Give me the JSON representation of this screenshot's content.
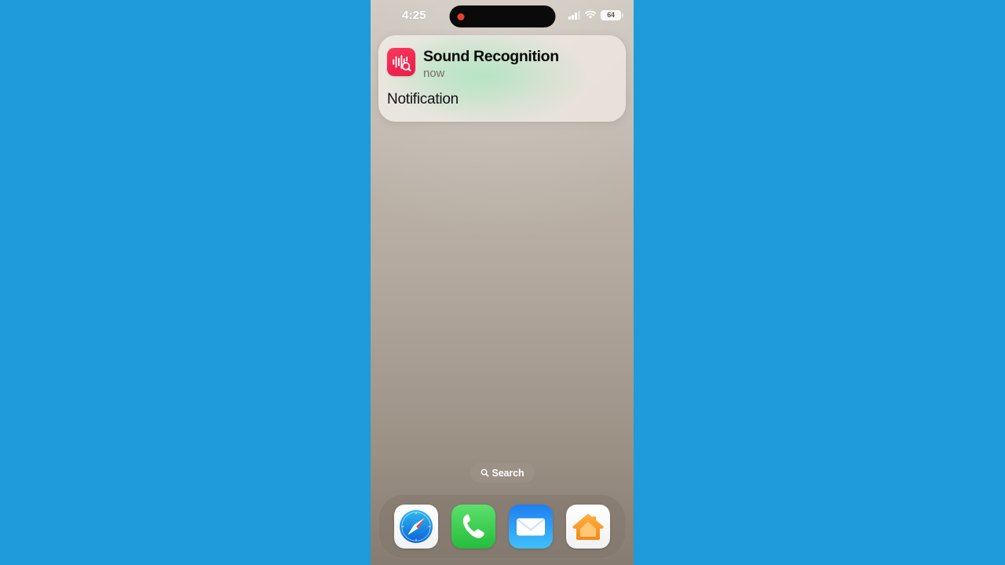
{
  "stage": {
    "background_color": "#1d9bdb"
  },
  "phone": {
    "wallpaper_colors": [
      "#cfc8bf",
      "#877c72"
    ]
  },
  "status_bar": {
    "time": "4:25",
    "cellular_icon": "cellular-bars-icon",
    "wifi_icon": "wifi-icon",
    "battery": {
      "level_text": "64",
      "icon": "battery-icon"
    }
  },
  "dynamic_island": {
    "recording_indicator_color": "#e8412f",
    "recording_icon": "recording-dot-icon"
  },
  "notification": {
    "app_icon": "sound-recognition-icon",
    "app_icon_color": "#f2264f",
    "app_name": "Sound Recognition",
    "time": "now",
    "body": "Notification"
  },
  "search": {
    "label": "Search",
    "icon": "magnifier-icon"
  },
  "dock": {
    "apps": [
      {
        "name": "Safari",
        "icon": "safari-compass-icon",
        "color": "#1c8ae8"
      },
      {
        "name": "Phone",
        "icon": "phone-handset-icon",
        "color": "#4cd964"
      },
      {
        "name": "Mail",
        "icon": "mail-envelope-icon",
        "color": "#1f87f0"
      },
      {
        "name": "Home",
        "icon": "home-house-icon",
        "color": "#f5a623"
      }
    ]
  }
}
